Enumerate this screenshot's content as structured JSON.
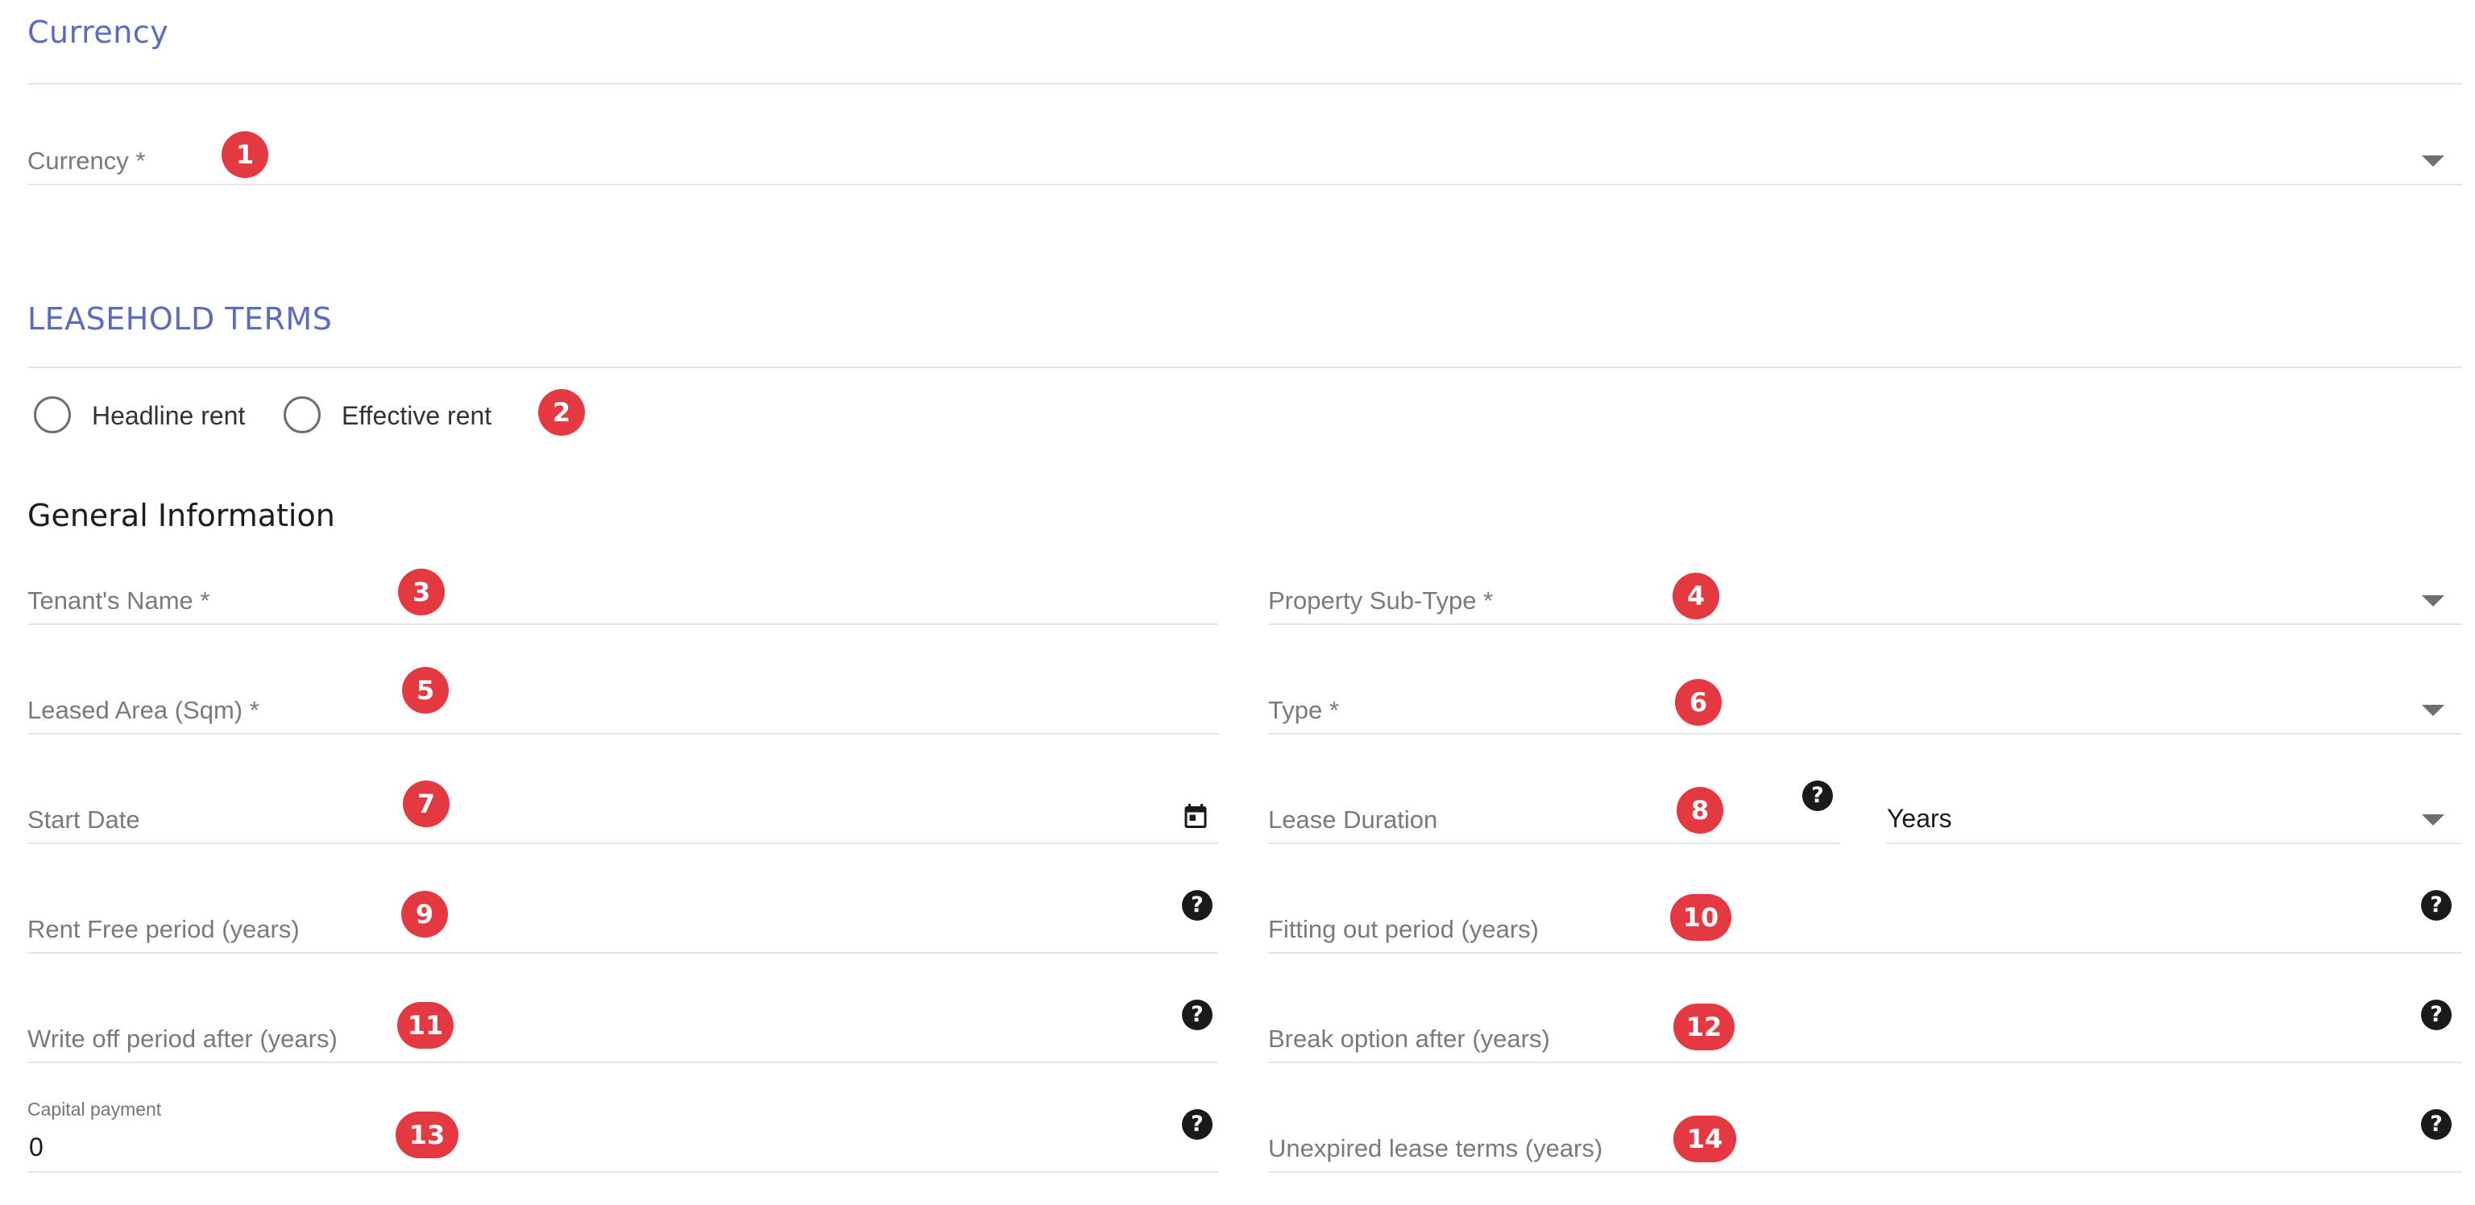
{
  "currency_section": {
    "title": "Currency",
    "field_label": "Currency *",
    "value": ""
  },
  "leasehold_section": {
    "title": "LEASEHOLD TERMS",
    "rent_options": [
      "Headline rent",
      "Effective rent"
    ],
    "selected_rent": null
  },
  "general_info": {
    "title": "General Information",
    "fields": {
      "tenant_name": {
        "label": "Tenant's Name *",
        "value": ""
      },
      "property_sub_type": {
        "label": "Property Sub-Type *",
        "value": ""
      },
      "leased_area": {
        "label": "Leased Area (Sqm) *",
        "value": ""
      },
      "type": {
        "label": "Type *",
        "value": ""
      },
      "start_date": {
        "label": "Start Date",
        "value": ""
      },
      "lease_duration": {
        "label": "Lease Duration",
        "value": "",
        "unit": "Years"
      },
      "rent_free_period": {
        "label": "Rent Free period (years)",
        "value": ""
      },
      "fitting_out_period": {
        "label": "Fitting out period (years)",
        "value": ""
      },
      "write_off_period": {
        "label": "Write off period after (years)",
        "value": ""
      },
      "break_option": {
        "label": "Break option after (years)",
        "value": ""
      },
      "capital_payment": {
        "label": "Capital payment",
        "value": "0"
      },
      "unexpired_lease_terms": {
        "label": "Unexpired lease terms (years)",
        "value": ""
      }
    }
  },
  "annotation_badges": [
    "1",
    "2",
    "3",
    "4",
    "5",
    "6",
    "7",
    "8",
    "9",
    "10",
    "11",
    "12",
    "13",
    "14"
  ],
  "icons": {
    "dropdown": "triangle-down",
    "help": "?",
    "calendar": "calendar-icon"
  },
  "colors": {
    "section_title": "#5c6bc0",
    "badge": "#e53941",
    "help_icon": "#1a1a1a"
  }
}
